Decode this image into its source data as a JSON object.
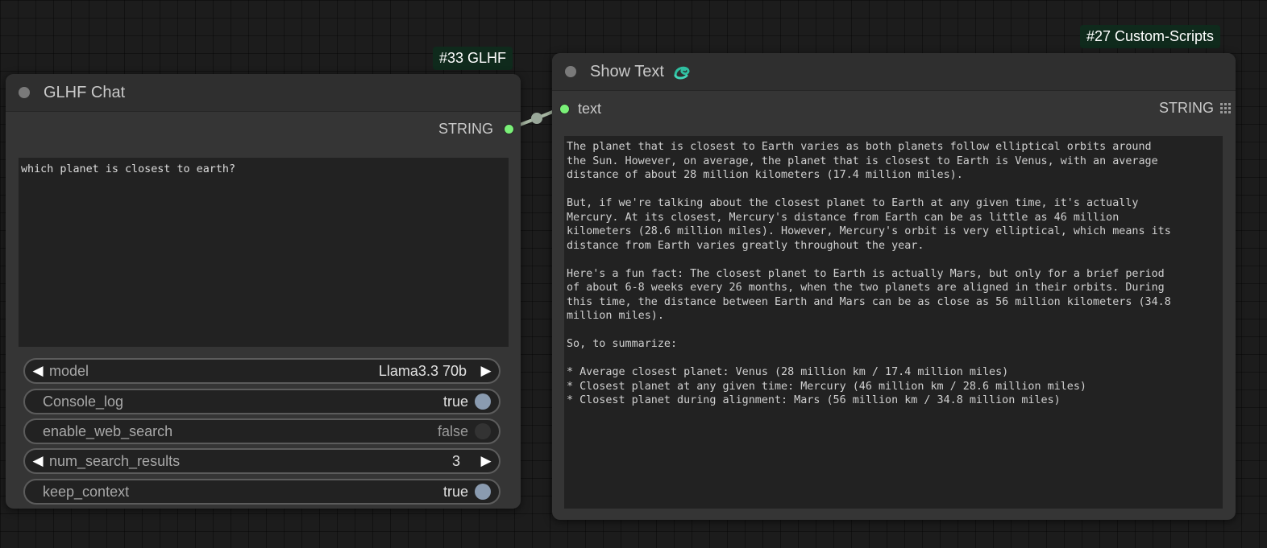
{
  "badges": {
    "glhf": "#33 GLHF",
    "custom_scripts": "#27 Custom-Scripts"
  },
  "glhf_node": {
    "title": "GLHF Chat",
    "output_label": "STRING",
    "prompt": "which planet is closest to earth?",
    "widgets": {
      "model": {
        "label": "model",
        "value": "Llama3.3 70b"
      },
      "console_log": {
        "label": "Console_log",
        "value": "true"
      },
      "enable_web_search": {
        "label": "enable_web_search",
        "value": "false"
      },
      "num_search_results": {
        "label": "num_search_results",
        "value": "3"
      },
      "keep_context": {
        "label": "keep_context",
        "value": "true"
      }
    }
  },
  "show_text_node": {
    "title": "Show Text",
    "icon": "snake-icon",
    "input_label": "text",
    "output_label": "STRING",
    "text": "The planet that is closest to Earth varies as both planets follow elliptical orbits around\nthe Sun. However, on average, the planet that is closest to Earth is Venus, with an average\ndistance of about 28 million kilometers (17.4 million miles).\n\nBut, if we're talking about the closest planet to Earth at any given time, it's actually\nMercury. At its closest, Mercury's distance from Earth can be as little as 46 million\nkilometers (28.6 million miles). However, Mercury's orbit is very elliptical, which means its\ndistance from Earth varies greatly throughout the year.\n\nHere's a fun fact: The closest planet to Earth is actually Mars, but only for a brief period\nof about 6-8 weeks every 26 months, when the two planets are aligned in their orbits. During\nthis time, the distance between Earth and Mars can be as close as 56 million kilometers (34.8\nmillion miles).\n\nSo, to summarize:\n\n* Average closest planet: Venus (28 million km / 17.4 million miles)\n* Closest planet at any given time: Mercury (46 million km / 28.6 million miles)\n* Closest planet during alignment: Mars (56 million km / 34.8 million miles)"
  },
  "colors": {
    "slot_string": "#7af078",
    "badge_bg": "#0f2a1c",
    "node_bg": "#353535",
    "toggle_on": "#8a9bb0"
  }
}
